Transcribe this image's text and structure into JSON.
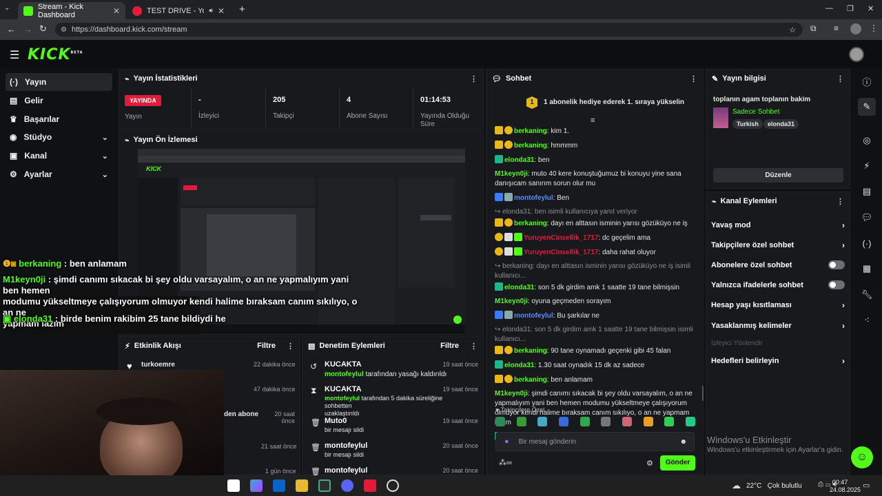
{
  "browser": {
    "tabs": [
      {
        "title": "Stream - Kick Dashboard",
        "active": true
      },
      {
        "title": "TEST DRIVE - YouTube Musi",
        "active": false
      }
    ],
    "url": "https://dashboard.kick.com/stream",
    "win_min": "—",
    "win_max": "❐",
    "win_close": "✕"
  },
  "app": {
    "logo": "KICK",
    "logo_sup": "BETA"
  },
  "sidebar": {
    "items": [
      {
        "label": "Yayın",
        "icon": "signal-icon",
        "glyph": "(·)"
      },
      {
        "label": "Gelir",
        "icon": "money-icon",
        "glyph": "▤"
      },
      {
        "label": "Başarılar",
        "icon": "trophy-icon",
        "glyph": "♛"
      },
      {
        "label": "Stüdyo",
        "icon": "studio-icon",
        "glyph": "◉"
      },
      {
        "label": "Kanal",
        "icon": "channel-icon",
        "glyph": "▣"
      },
      {
        "label": "Ayarlar",
        "icon": "gear-icon",
        "glyph": "⚙"
      }
    ]
  },
  "stats": {
    "title": "Yayın İstatistikleri",
    "live": "YAYINDA",
    "live_label": "Yayın",
    "viewers": "-",
    "viewers_label": "İzleyici",
    "followers": "205",
    "followers_label": "Takipçi",
    "subs": "4",
    "subs_label": "Abone Sayısı",
    "uptime": "01:14:53",
    "uptime_label": "Yayında Olduğu Süre"
  },
  "preview": {
    "title": "Yayın Ön İzlemesi"
  },
  "activity": {
    "title": "Etkinlik Akışı",
    "filter": "Filtre",
    "items": [
      {
        "name": "turkoemre",
        "time": "22 dakika önce"
      },
      {
        "name": "",
        "time": "47 dakika önce"
      },
      {
        "name": "den abone",
        "time": "20 saat önce"
      },
      {
        "name": "",
        "time": "21 saat önce"
      },
      {
        "name": "",
        "time": "1 gün önce"
      }
    ]
  },
  "mod": {
    "title": "Denetim Eylemleri",
    "filter": "Filtre",
    "items": [
      {
        "name": "KUCAKTA",
        "actor": "montofeylul",
        "text": "tarafından yasağı kaldırıldı",
        "text2": "",
        "time": "19 saat önce"
      },
      {
        "name": "KUCAKTA",
        "actor": "montofeylul",
        "text": "tarafından 5 dakika süreliğine sohbetten",
        "text2": "uzaklaştırıldı",
        "time": "19 saat önce"
      },
      {
        "name": "Muto0",
        "actor": "",
        "text": "bir mesajı sildi",
        "text2": "",
        "time": "19 saat önce"
      },
      {
        "name": "montofeylul",
        "actor": "",
        "text": "bir mesajı sildi",
        "text2": "",
        "time": "20 saat önce"
      },
      {
        "name": "montofeylul",
        "actor": "",
        "text": "",
        "text2": "",
        "time": "20 saat önce"
      }
    ]
  },
  "chat": {
    "title": "Sohbet",
    "pinned": "1 abonelik hediye ederek 1. sıraya yükselin",
    "followers_only": "Takipçilere Özel",
    "placeholder": "Bir mesaj gönderin",
    "send": "Gönder",
    "messages": [
      {
        "user": "berkaning",
        "color": "#53fc18",
        "text": "kim 1.",
        "badges": "crown"
      },
      {
        "user": "berkaning",
        "color": "#53fc18",
        "text": "hmmmm",
        "badges": "crown"
      },
      {
        "user": "elonda31",
        "color": "#53fc18",
        "text": "ben",
        "badges": "none"
      },
      {
        "user": "M1keyn0ji",
        "color": "#53fc18",
        "text": "muto 40 kere konuştuğumuz bi konuyu yine sana",
        "text2": "danışıcam sanırım sorun olur mu",
        "badges": "plain"
      },
      {
        "user": "montofeylul",
        "color": "#5b8cff",
        "text": "Ben",
        "badges": "mod"
      },
      {
        "reply": "elonda31: ben isimli kullanıcıya yanıt veriyor"
      },
      {
        "user": "berkaning",
        "color": "#53fc18",
        "text": "dayı en alttasın isminin yarısı gözüküyo ne iş",
        "badges": "crown"
      },
      {
        "user": "YuruyenCinsellik_1717",
        "color": "#e01b3c",
        "text": "dc geçelim ama",
        "badges": "sub"
      },
      {
        "user": "YuruyenCinsellik_1717",
        "color": "#e01b3c",
        "text": "daha rahat oluyor",
        "badges": "sub"
      },
      {
        "reply": "berkaning: dayı en alttasın isminin yarısı gözüküyo ne iş isimli kullanıcı..."
      },
      {
        "user": "elonda31",
        "color": "#53fc18",
        "text": "son 5 dk girdim amk 1 saatte 19 tane bilmişsin",
        "badges": "none"
      },
      {
        "user": "M1keyn0ji",
        "color": "#53fc18",
        "text": "oyuna geçmeden sorayım",
        "badges": "plain"
      },
      {
        "user": "montofeylul",
        "color": "#5b8cff",
        "text": "Bu şarkılar ne",
        "badges": "mod"
      },
      {
        "reply": "elonda31: son 5 dk girdim amk 1 saatte 19 tane bilmişsin isimli kullanıcı..."
      },
      {
        "user": "berkaning",
        "color": "#53fc18",
        "text": "90 tane oynamadı geçenki gibi 45 falan",
        "badges": "crown"
      },
      {
        "user": "elonda31",
        "color": "#53fc18",
        "text": "1.30 saat oynadık 15 dk az sadece",
        "badges": "none"
      },
      {
        "user": "berkaning",
        "color": "#53fc18",
        "text": "ben anlamam",
        "badges": "crown"
      },
      {
        "user": "M1keyn0ji",
        "color": "#53fc18",
        "text": "şimdi canımı sıkacak bi şey oldu varsayalım, o an ne",
        "text2": "yapmalıyım yani ben hemen modumu yükseltmeye çalışıyorum",
        "text3": "olmuyor kendi halime bıraksam canım sıkılıyo, o an ne yapmam lazım",
        "badges": "plain"
      },
      {
        "user": "elonda31",
        "color": "#53fc18",
        "text": "birde benim rakibim 25 tane bildiydi he",
        "badges": "none"
      }
    ]
  },
  "stream_info": {
    "title": "Yayın bilgisi",
    "stream_title": "toplanın agam toplanın bakim",
    "category": "Sadece Sohbet",
    "tags": [
      "Turkish",
      "elonda31"
    ],
    "edit": "Düzenle"
  },
  "channel_actions": {
    "title": "Kanal Eylemleri",
    "items": [
      {
        "label": "Yavaş mod",
        "type": "chevron"
      },
      {
        "label": "Takipçilere özel sohbet",
        "type": "chevron"
      },
      {
        "label": "Abonelere özel sohbet",
        "type": "toggle"
      },
      {
        "label": "Yalnızca ifadelerle sohbet",
        "type": "toggle"
      },
      {
        "label": "Hesap yaşı kısıtlaması",
        "type": "chevron"
      },
      {
        "label": "Yasaklanmış kelimeler",
        "type": "chevron"
      }
    ],
    "disabled": "İzleyici Yönlendir",
    "goals": "Hedefleri belirleyin"
  },
  "overlay": {
    "l1_user": "berkaning",
    "l1_text": " : ben anlamam",
    "l2_user": "M1keyn0ji",
    "l2_text": " : şimdi canımı sıkacak bi şey oldu varsayalım, o an ne yapmalıyım yani ben hemen",
    "l3": "modumu yükseltmeye çalışıyorum olmuyor kendi halime bıraksam canım sıkılıyo, o an ne",
    "l4": "yapmam lazım",
    "l5_user": "elonda31",
    "l5_text": " : birde benim rakibim 25 tane bildiydi he"
  },
  "windows": {
    "activate": "Windows'u Etkinleştir",
    "activate_sub": "Windows'u etkinleştirmek için Ayarlar'a gidin."
  },
  "taskbar": {
    "temp": "22°C",
    "weather": "Çok bulutlu",
    "time": "00:47",
    "date": "24.08.2025"
  },
  "colors": {
    "accent": "#53fc18",
    "live": "#e01b3c",
    "panel": "#17191c"
  }
}
